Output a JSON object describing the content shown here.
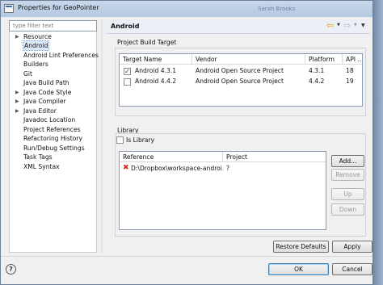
{
  "window": {
    "title": "Properties for GeoPointer",
    "ghost_title": "Sarah Brooks"
  },
  "filter": {
    "placeholder": "type filter text",
    "value": ""
  },
  "tree": {
    "items": [
      {
        "label": "Resource",
        "expandable": true,
        "selected": false
      },
      {
        "label": "Android",
        "expandable": false,
        "selected": true
      },
      {
        "label": "Android Lint Preferences",
        "expandable": false,
        "selected": false
      },
      {
        "label": "Builders",
        "expandable": false,
        "selected": false
      },
      {
        "label": "Git",
        "expandable": false,
        "selected": false
      },
      {
        "label": "Java Build Path",
        "expandable": false,
        "selected": false
      },
      {
        "label": "Java Code Style",
        "expandable": true,
        "selected": false
      },
      {
        "label": "Java Compiler",
        "expandable": true,
        "selected": false
      },
      {
        "label": "Java Editor",
        "expandable": true,
        "selected": false
      },
      {
        "label": "Javadoc Location",
        "expandable": false,
        "selected": false
      },
      {
        "label": "Project References",
        "expandable": false,
        "selected": false
      },
      {
        "label": "Refactoring History",
        "expandable": false,
        "selected": false
      },
      {
        "label": "Run/Debug Settings",
        "expandable": false,
        "selected": false
      },
      {
        "label": "Task Tags",
        "expandable": false,
        "selected": false
      },
      {
        "label": "XML Syntax",
        "expandable": false,
        "selected": false
      }
    ]
  },
  "page": {
    "title": "Android",
    "nav": {
      "back_icon": "back-arrow-icon",
      "forward_icon": "forward-arrow-icon",
      "menu_icon": "view-menu-icon"
    }
  },
  "build_target": {
    "section_label": "Project Build Target",
    "headers": [
      "Target Name",
      "Vendor",
      "Platform",
      "API ..."
    ],
    "rows": [
      {
        "checked": true,
        "name": "Android 4.3.1",
        "vendor": "Android Open Source Project",
        "platform": "4.3.1",
        "api": "18"
      },
      {
        "checked": false,
        "name": "Android 4.4.2",
        "vendor": "Android Open Source Project",
        "platform": "4.4.2",
        "api": "19"
      }
    ]
  },
  "library": {
    "section_label": "Library",
    "is_library_label": "Is Library",
    "is_library_checked": false,
    "headers": [
      "Reference",
      "Project"
    ],
    "rows": [
      {
        "status_icon": "error-icon",
        "reference": "D:\\Dropbox\\workspace-androi...",
        "project": "?"
      }
    ],
    "buttons": [
      {
        "label": "Add...",
        "enabled": true
      },
      {
        "label": "Remove",
        "enabled": false
      },
      {
        "label": "Up",
        "enabled": false
      },
      {
        "label": "Down",
        "enabled": false
      }
    ]
  },
  "actions": {
    "restore_defaults": "Restore Defaults",
    "apply": "Apply",
    "ok": "OK",
    "cancel": "Cancel",
    "help_icon": "help-icon"
  },
  "colors": {
    "selection": "#dce8f7",
    "error": "#d42a1e",
    "back_arrow": "#e0a000",
    "title_bar": "#b3c8e0"
  }
}
